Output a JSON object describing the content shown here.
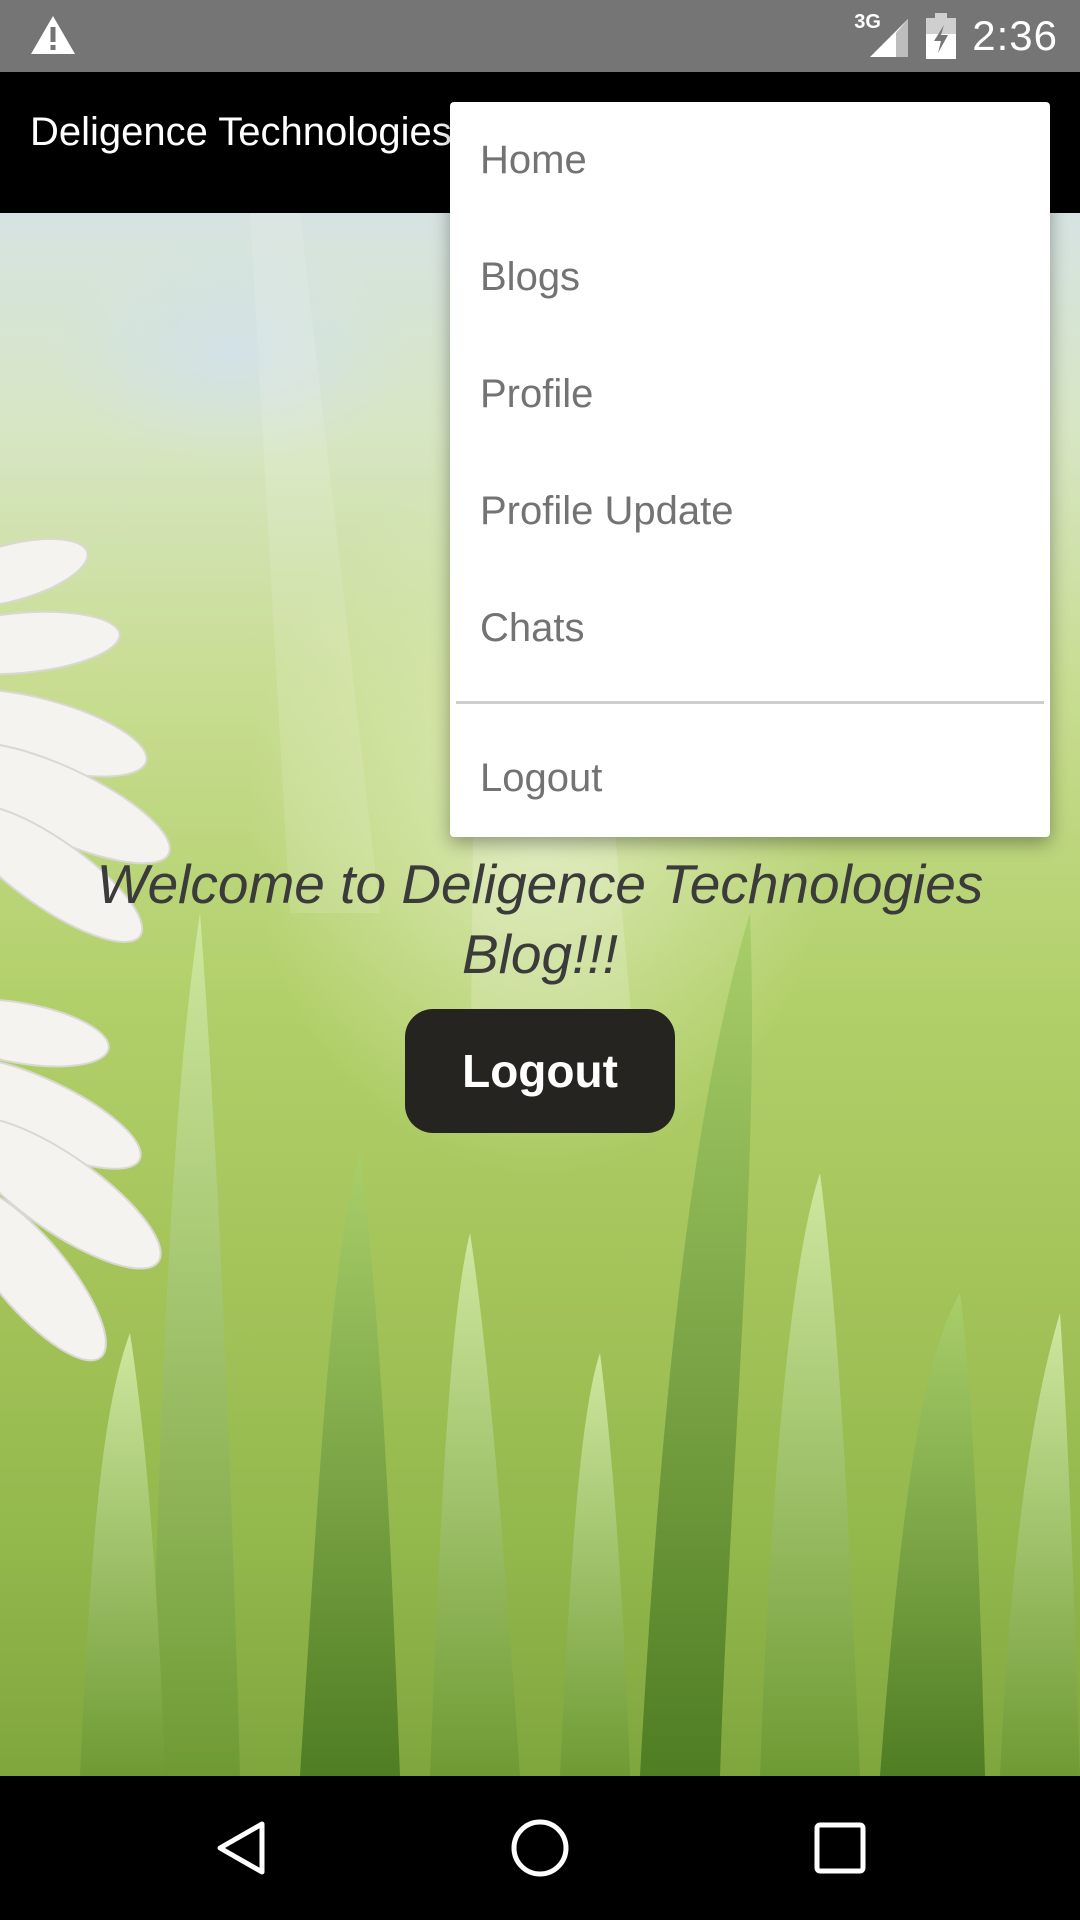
{
  "status_bar": {
    "network": "3G",
    "time": "2:36",
    "icons": [
      "warning-icon",
      "signal-icon",
      "battery-charging-icon"
    ]
  },
  "app_bar": {
    "title": "Deligence Technologies"
  },
  "menu": {
    "items": [
      {
        "label": "Home"
      },
      {
        "label": "Blogs"
      },
      {
        "label": "Profile"
      },
      {
        "label": "Profile Update"
      },
      {
        "label": "Chats"
      },
      {
        "label": "Logout"
      }
    ]
  },
  "main": {
    "welcome_text": "Welcome to Deligence Technologies Blog!!!",
    "logout_button": "Logout"
  },
  "nav_bar": {
    "icons": [
      "back-icon",
      "home-icon",
      "recents-icon"
    ]
  },
  "colors": {
    "status_bar": "#757575",
    "app_bar": "#000000",
    "button": "#262421",
    "menu_text": "#737373"
  }
}
